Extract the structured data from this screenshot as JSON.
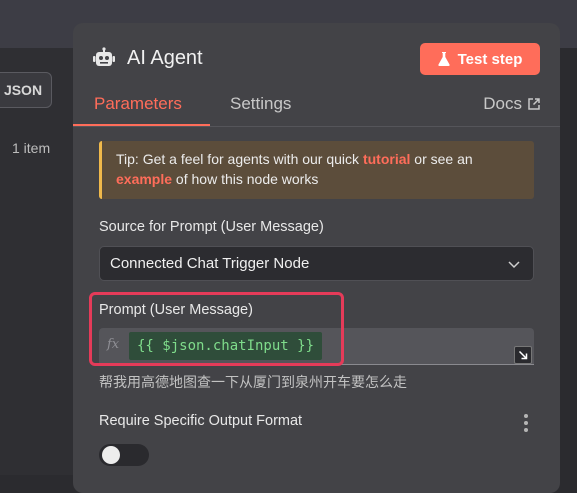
{
  "background": {
    "json_label": "JSON",
    "item_count": "1 item"
  },
  "panel": {
    "title": "AI Agent",
    "icon": "robot-icon",
    "test_button": "Test step",
    "test_icon": "flask-icon",
    "accent": "#ff6d5a"
  },
  "tabs": {
    "parameters": "Parameters",
    "settings": "Settings",
    "docs": "Docs"
  },
  "tip": {
    "prefix": "Tip: Get a feel for agents with our quick ",
    "link1": "tutorial",
    "middle": " or see an ",
    "link2": "example",
    "suffix": " of how this node works"
  },
  "source": {
    "label": "Source for Prompt (User Message)",
    "value": "Connected Chat Trigger Node"
  },
  "prompt": {
    "label": "Prompt (User Message)",
    "fx": "fx",
    "expression": "{{ $json.chatInput }}",
    "preview": "帮我用高德地图查一下从厦门到泉州开车要怎么走"
  },
  "output_format": {
    "label": "Require Specific Output Format",
    "enabled": false
  }
}
